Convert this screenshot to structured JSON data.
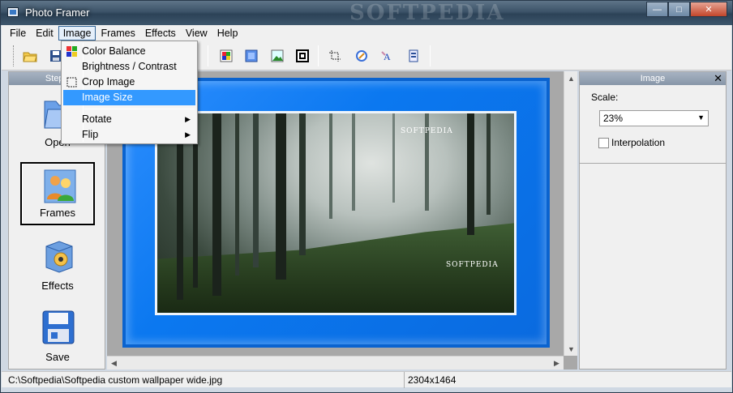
{
  "window": {
    "title": "Photo Framer",
    "titlebar_watermark": "SOFTPEDIA"
  },
  "caption_buttons": {
    "minimize": "—",
    "maximize": "□",
    "close": "✕"
  },
  "menubar": [
    "File",
    "Edit",
    "Image",
    "Frames",
    "Effects",
    "View",
    "Help"
  ],
  "image_menu": {
    "items": [
      {
        "label": "Color Balance",
        "icon": "color-balance-icon"
      },
      {
        "label": "Brightness / Contrast"
      },
      {
        "label": "Crop Image",
        "icon": "crop-icon"
      },
      {
        "label": "Image Size",
        "highlighted": true
      },
      {
        "label": "Rotate",
        "submenu": true
      },
      {
        "label": "Flip",
        "submenu": true
      }
    ]
  },
  "toolbar": {
    "icons": [
      "open-folder-icon",
      "save-icon",
      "color-icon",
      "fill-icon",
      "picture-icon",
      "frame-icon",
      "crop-icon",
      "magic-icon",
      "text-icon",
      "bookmark-icon"
    ]
  },
  "steps_panel": {
    "header": "Steps",
    "items": [
      {
        "label": "Open",
        "icon": "open-folder-icon"
      },
      {
        "label": "Frames",
        "icon": "frames-people-icon",
        "selected": true
      },
      {
        "label": "Effects",
        "icon": "effects-box-icon"
      },
      {
        "label": "Save",
        "icon": "floppy-disk-icon"
      }
    ]
  },
  "canvas": {
    "frame_color": "#0b78f0",
    "photo_watermark_1": "SOFTPEDIA",
    "photo_watermark_2": "SOFTPEDIA"
  },
  "image_panel": {
    "header": "Image",
    "close": "✕",
    "scale_label": "Scale:",
    "scale_value": "23%",
    "interpolation_label": "Interpolation",
    "interpolation_checked": false
  },
  "statusbar": {
    "path": "C:\\Softpedia\\Softpedia custom wallpaper wide.jpg",
    "dimensions": "2304x1464"
  }
}
